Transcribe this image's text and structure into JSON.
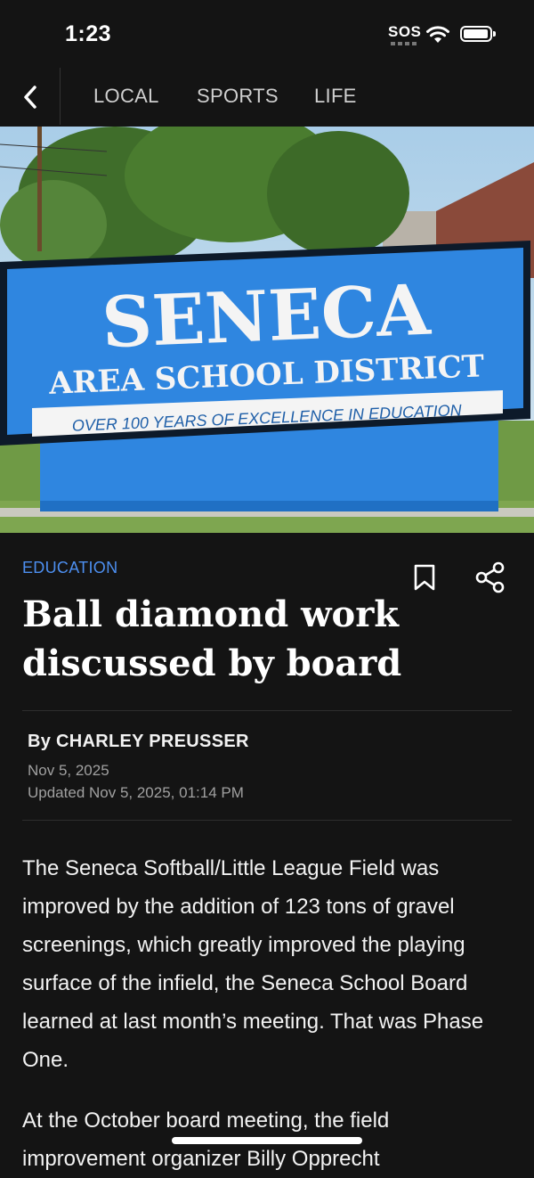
{
  "status_bar": {
    "time": "1:23",
    "sos": "SOS"
  },
  "nav": {
    "tabs": [
      "LOCAL",
      "SPORTS",
      "LIFE"
    ]
  },
  "hero": {
    "sign_title": "SENECA",
    "sign_subtitle": "AREA SCHOOL DISTRICT",
    "sign_tagline": "OVER 100 YEARS OF EXCELLENCE IN EDUCATION"
  },
  "article": {
    "category": "EDUCATION",
    "headline": "Ball diamond work discussed by board",
    "byline": "By CHARLEY PREUSSER",
    "date": "Nov 5, 2025",
    "updated": "Updated Nov 5, 2025, 01:14 PM",
    "paragraphs": [
      "The Seneca Softball/Little League Field was improved by the addition of 123 tons of gravel screenings, which greatly improved the playing surface of the infield, the Seneca School Board learned at last month’s meeting. That was Phase One.",
      "At the October board meeting, the field improvement organizer Billy Opprecht"
    ]
  },
  "colors": {
    "background": "#141414",
    "category": "#4d8ff0",
    "sign_blue": "#2f86e0"
  },
  "icons": [
    "back-chevron-icon",
    "bookmark-icon",
    "share-icon",
    "wifi-icon",
    "battery-icon"
  ]
}
